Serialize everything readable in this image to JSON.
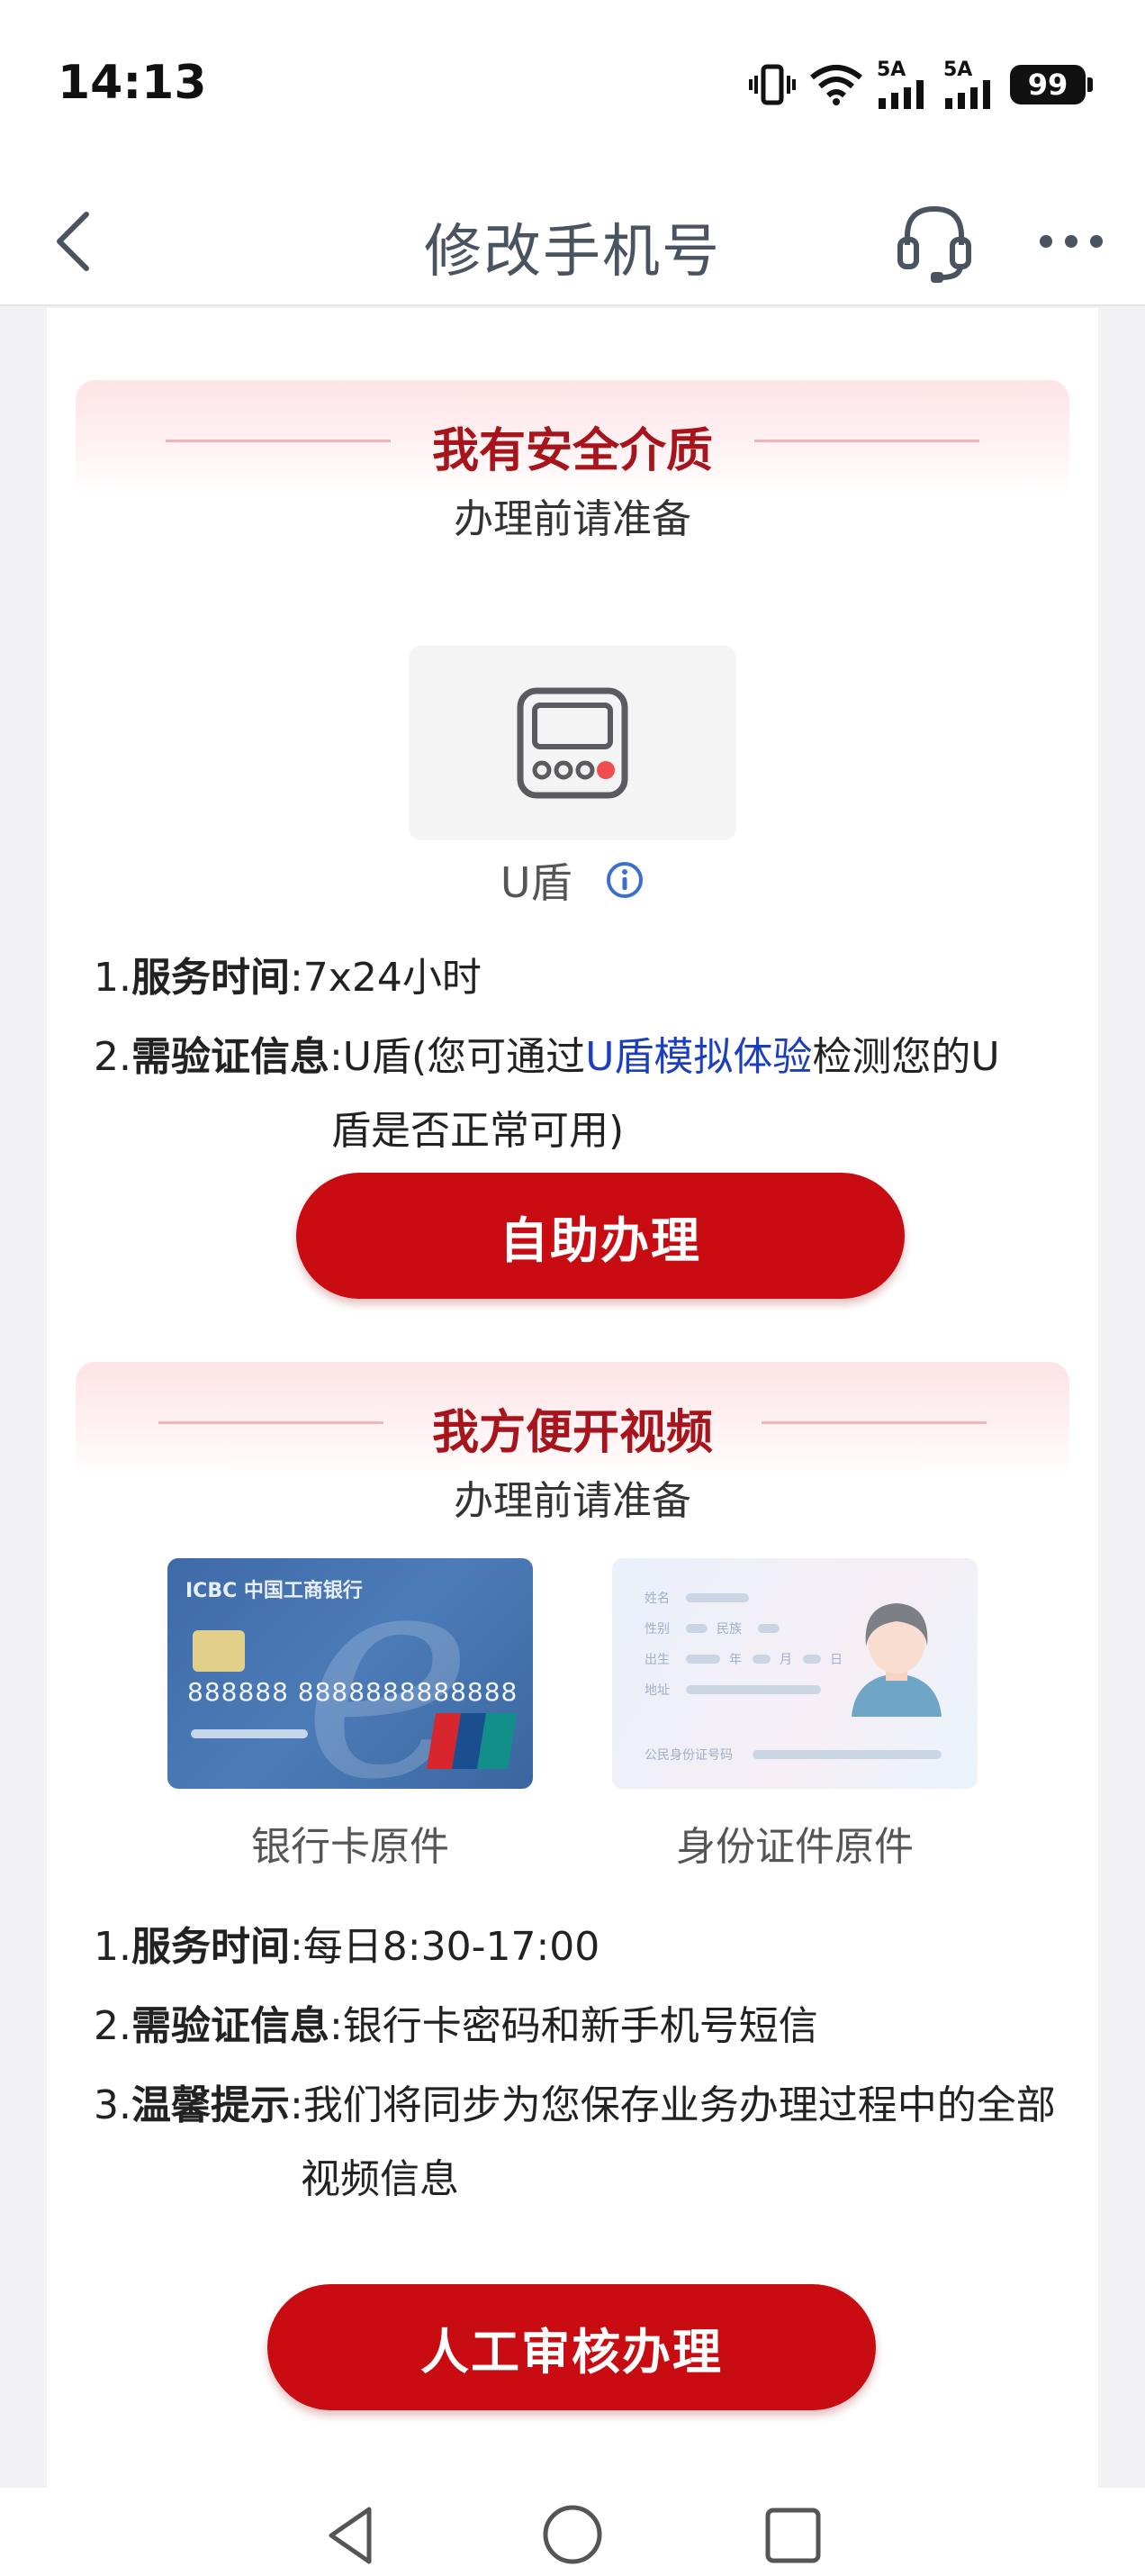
{
  "status_bar": {
    "time": "14:13",
    "signal1_label": "5A",
    "signal2_label": "5A",
    "battery": "99"
  },
  "nav": {
    "title": "修改手机号"
  },
  "section1": {
    "title": "我有安全介质",
    "subtitle": "办理前请准备",
    "medium_label": "U盾",
    "line1_num": "1.",
    "line1_key": "服务时间",
    "line1_val": ":7x24小时",
    "line2_num": "2.",
    "line2_key": "需验证信息",
    "line2_val_a": ":U盾(您可通过",
    "line2_link": "U盾模拟体验",
    "line2_val_b": "检测您的U",
    "line2_cont": "盾是否正常可用)",
    "button": "自助办理"
  },
  "section2": {
    "title": "我方便开视频",
    "subtitle": "办理前请准备",
    "doc1_label": "银行卡原件",
    "doc2_label": "身份证件原件",
    "bank_card": {
      "logo": "ICBC  中国工商银行",
      "number": "888888 8888888888888"
    },
    "id_card": {
      "name": "姓名",
      "sex": "性别",
      "ethnic": "民族",
      "birth": "出生",
      "year": "年",
      "month": "月",
      "day": "日",
      "address": "地址",
      "id_no": "公民身份证号码"
    },
    "line1_num": "1.",
    "line1_key": "服务时间",
    "line1_val": ":每日8:30-17:00",
    "line2_num": "2.",
    "line2_key": "需验证信息",
    "line2_val": ":银行卡密码和新手机号短信",
    "line3_num": "3.",
    "line3_key": "温馨提示",
    "line3_val": ":我们将同步为您保存业务办理过程中的全部",
    "line3_cont": "视频信息",
    "button": "人工审核办理"
  },
  "colors": {
    "accent_red": "#c90b12",
    "title_red": "#a8141c",
    "link_blue": "#1b3fbf"
  },
  "icons": [
    "back-arrow-icon",
    "headset-icon",
    "more-icon",
    "ukey-icon",
    "info-icon",
    "back-triangle-icon",
    "home-circle-icon",
    "recents-square-icon"
  ]
}
